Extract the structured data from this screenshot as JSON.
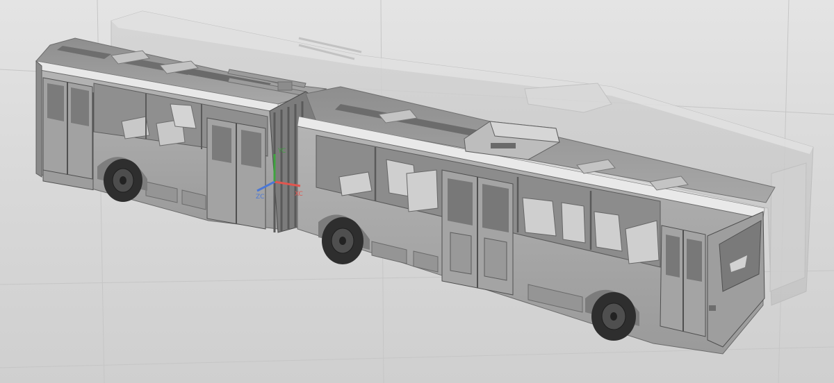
{
  "viewport": {
    "background_top": "#e4e4e4",
    "background_bottom": "#cfcfcf",
    "model_color": "#a3a3a3",
    "ghost_color": "#c9c9c9"
  },
  "triad": {
    "x_label": "XC",
    "y_label": "YC",
    "z_label": "ZC",
    "x_color": "#e0564f",
    "y_color": "#3fa33f",
    "z_color": "#4b78d6"
  }
}
